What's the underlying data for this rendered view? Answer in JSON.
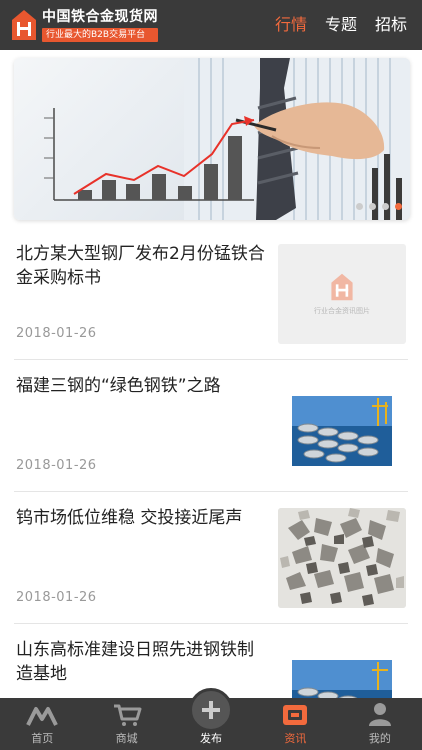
{
  "header": {
    "site_name": "中国铁合金现货网",
    "slogan": "行业最大的B2B交易平台",
    "nav": [
      {
        "label": "行情",
        "active": true
      },
      {
        "label": "专题",
        "active": false
      },
      {
        "label": "招标",
        "active": false
      }
    ]
  },
  "banner": {
    "slide_count": 4,
    "active_index": 3
  },
  "news": [
    {
      "title": "北方某大型钢厂发布2月份锰铁合金采购标书",
      "date": "2018-01-26",
      "thumb": "placeholder",
      "placeholder_text": "行业合金资讯图片"
    },
    {
      "title": "福建三钢的“绿色钢铁”之路",
      "date": "2018-01-26",
      "thumb": "steel-bars"
    },
    {
      "title": "钨市场低位维稳 交投接近尾声",
      "date": "2018-01-26",
      "thumb": "ore"
    },
    {
      "title": "山东高标准建设日照先进钢铁制造基地",
      "date": "",
      "thumb": "steel-bars"
    }
  ],
  "tabbar": [
    {
      "label": "首页",
      "icon": "home-icon"
    },
    {
      "label": "商城",
      "icon": "cart-icon"
    },
    {
      "label": "发布",
      "icon": "publish-icon"
    },
    {
      "label": "资讯",
      "icon": "news-icon",
      "active": true
    },
    {
      "label": "我的",
      "icon": "user-icon"
    }
  ],
  "colors": {
    "accent": "#f26a3d",
    "bar_bg": "#3a3a3a"
  }
}
